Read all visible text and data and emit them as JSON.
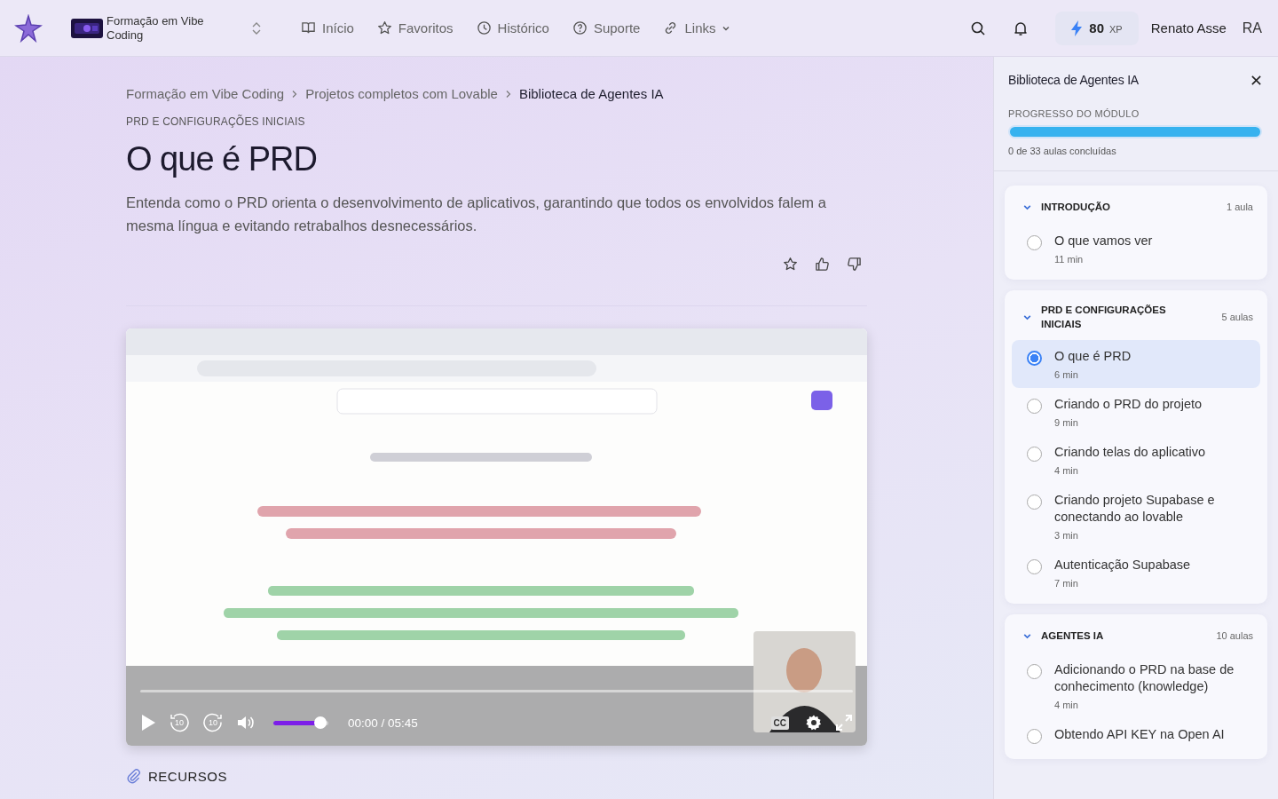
{
  "header": {
    "course": "Formação em Vibe Coding",
    "nav": [
      {
        "label": "Início",
        "dropdown": false
      },
      {
        "label": "Favoritos",
        "dropdown": false
      },
      {
        "label": "Histórico",
        "dropdown": false
      },
      {
        "label": "Suporte",
        "dropdown": false
      },
      {
        "label": "Links",
        "dropdown": true
      }
    ],
    "xp_value": "80",
    "xp_unit": "XP",
    "user_name": "Renato Asse",
    "user_initials": "RA"
  },
  "breadcrumb": [
    {
      "label": "Formação em Vibe Coding",
      "current": false
    },
    {
      "label": "Projetos completos com Lovable",
      "current": false
    },
    {
      "label": "Biblioteca de Agentes IA",
      "current": true
    }
  ],
  "lesson": {
    "module": "PRD E CONFIGURAÇÕES INICIAIS",
    "title": "O que é PRD",
    "description": "Entenda como o PRD orienta o desenvolvimento de aplicativos, garantindo que todos os envolvidos falem a mesma língua e evitando retrabalhos desnecessários."
  },
  "video": {
    "skip_back": "10",
    "skip_forward": "10",
    "volume": {
      "level": 0.85
    },
    "time": "00:00 / 05:45",
    "captions": "CC"
  },
  "resources": {
    "title": "RECURSOS"
  },
  "sidebar": {
    "title": "Biblioteca de Agentes IA",
    "progress_label": "PROGRESSO DO MÓDULO",
    "progress": {
      "level": 1
    },
    "progress_text": "0 de 33 aulas concluídas",
    "sections": [
      {
        "title": "INTRODUÇÃO",
        "count": "1 aula",
        "expanded": true,
        "lessons": [
          {
            "title": "O que vamos ver",
            "duration": "11 min",
            "selected": false
          }
        ]
      },
      {
        "title": "PRD E CONFIGURAÇÕES INICIAIS",
        "count": "5 aulas",
        "expanded": true,
        "lessons": [
          {
            "title": "O que é PRD",
            "duration": "6 min",
            "selected": true
          },
          {
            "title": "Criando o PRD do projeto",
            "duration": "9 min",
            "selected": false
          },
          {
            "title": "Criando telas do aplicativo",
            "duration": "4 min",
            "selected": false
          },
          {
            "title": "Criando projeto Supabase e conectando ao lovable",
            "duration": "3 min",
            "selected": false
          },
          {
            "title": "Autenticação Supabase",
            "duration": "7 min",
            "selected": false
          }
        ]
      },
      {
        "title": "AGENTES IA",
        "count": "10 aulas",
        "expanded": true,
        "lessons": [
          {
            "title": "Adicionando o PRD na base de conhecimento (knowledge)",
            "duration": "4 min",
            "selected": false
          },
          {
            "title": "Obtendo API KEY na Open AI",
            "selected": false
          }
        ]
      }
    ]
  }
}
